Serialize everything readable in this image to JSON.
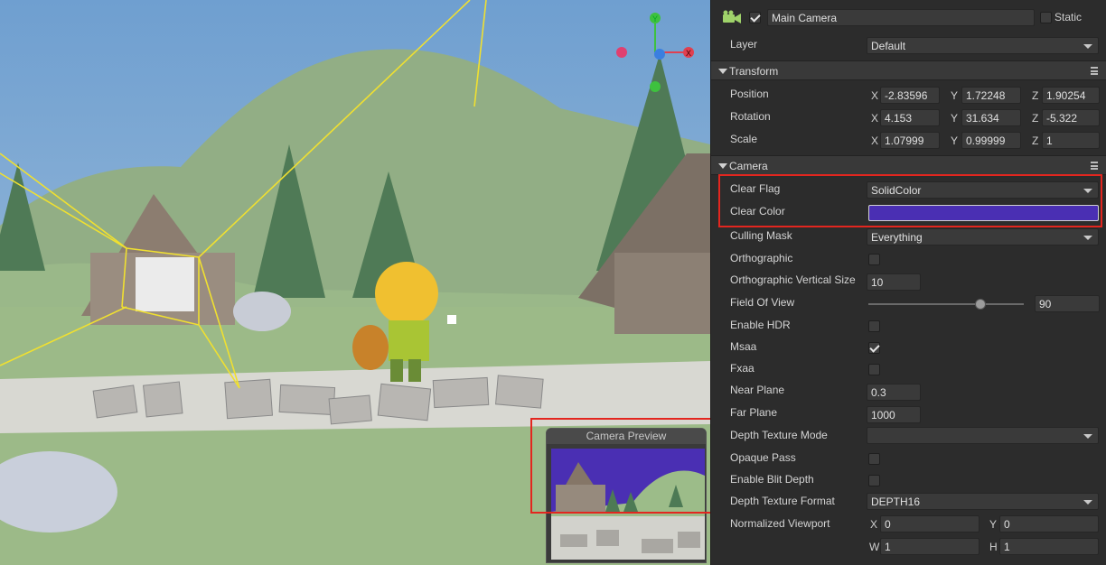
{
  "scene": {
    "preview_title": "Camera Preview",
    "preview_clear_color": "#4a2fb3",
    "sky_color": "#8fb1cf"
  },
  "header": {
    "icon": "camera-node-icon",
    "enabled": true,
    "name": "Main Camera",
    "static_label": "Static",
    "static_checked": false
  },
  "layer": {
    "label": "Layer",
    "value": "Default"
  },
  "transform": {
    "title": "Transform",
    "position": {
      "label": "Position",
      "x": "-2.83596",
      "y": "1.72248",
      "z": "1.90254"
    },
    "rotation": {
      "label": "Rotation",
      "x": "4.153",
      "y": "31.634",
      "z": "-5.322"
    },
    "scale": {
      "label": "Scale",
      "x": "1.07999",
      "y": "0.99999",
      "z": "1"
    },
    "axis": {
      "x": "X",
      "y": "Y",
      "z": "Z"
    }
  },
  "camera": {
    "title": "Camera",
    "clear_flag": {
      "label": "Clear Flag",
      "value": "SolidColor"
    },
    "clear_color": {
      "label": "Clear Color",
      "color": "#4a2fb3"
    },
    "culling_mask": {
      "label": "Culling Mask",
      "value": "Everything"
    },
    "orthographic": {
      "label": "Orthographic",
      "checked": false
    },
    "ortho_size": {
      "label": "Orthographic Vertical Size",
      "value": "10"
    },
    "fov": {
      "label": "Field Of View",
      "value": "90",
      "slider_fraction": 0.72
    },
    "hdr": {
      "label": "Enable HDR",
      "checked": false
    },
    "msaa": {
      "label": "Msaa",
      "checked": true
    },
    "fxaa": {
      "label": "Fxaa",
      "checked": false
    },
    "near": {
      "label": "Near Plane",
      "value": "0.3"
    },
    "far": {
      "label": "Far Plane",
      "value": "1000"
    },
    "depth_mode": {
      "label": "Depth Texture Mode",
      "value": ""
    },
    "opaque_pass": {
      "label": "Opaque Pass",
      "checked": false
    },
    "blit_depth": {
      "label": "Enable Blit Depth",
      "checked": false
    },
    "depth_format": {
      "label": "Depth Texture Format",
      "value": "DEPTH16"
    },
    "viewport": {
      "label": "Normalized Viewport",
      "x_label": "X",
      "x": "0",
      "y_label": "Y",
      "y": "0",
      "w_label": "W",
      "w": "1",
      "h_label": "H",
      "h": "1"
    }
  },
  "highlight_color": "#e3261f"
}
